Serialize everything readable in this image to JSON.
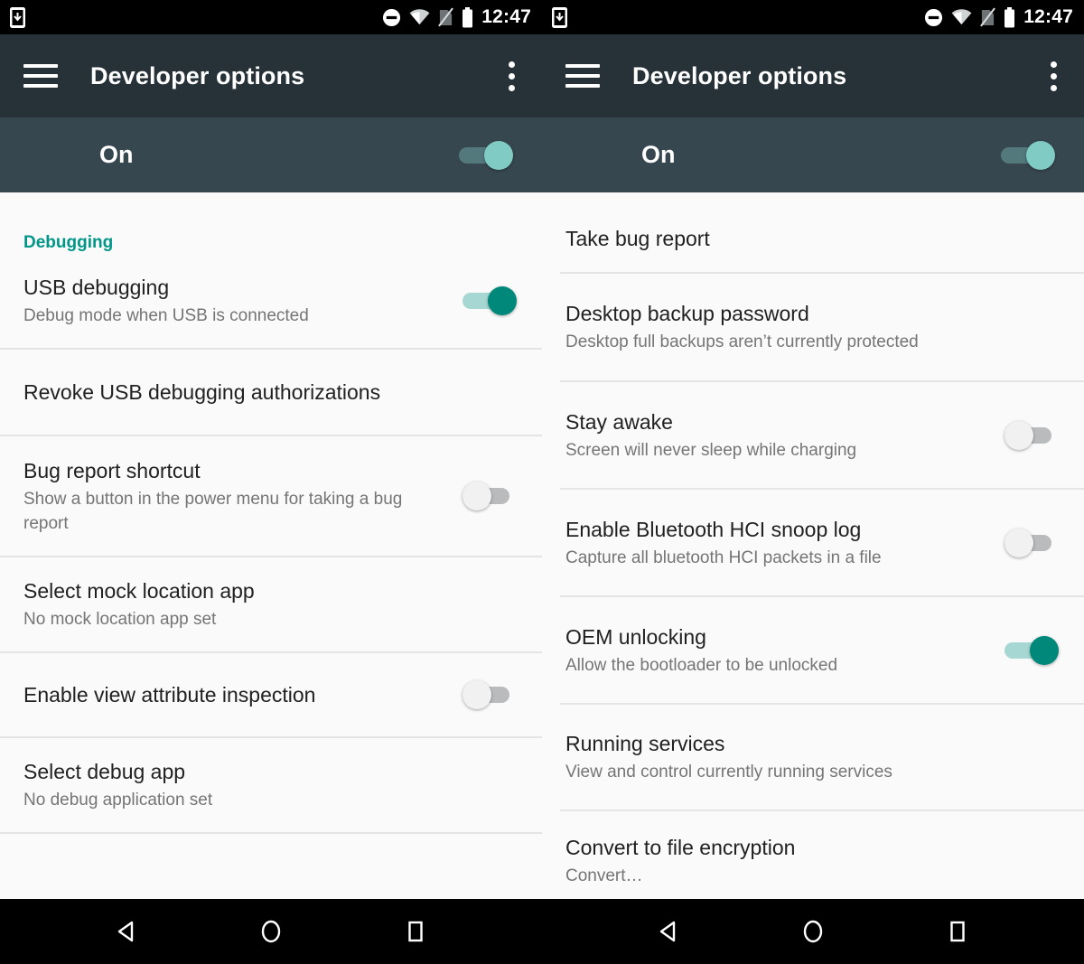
{
  "status_bar": {
    "left_icons": [
      "phone-download-icon"
    ],
    "right_icons": [
      "do-not-disturb-icon",
      "wifi-icon",
      "no-sim-icon",
      "battery-icon"
    ],
    "time": "12:47"
  },
  "toolbar": {
    "menu_icon": "hamburger-menu-icon",
    "title": "Developer options",
    "overflow_icon": "overflow-menu-icon"
  },
  "master_switch": {
    "label": "On",
    "state": "on"
  },
  "colors": {
    "accent_teal": "#009688",
    "toolbar_bg": "#263238",
    "master_bar_bg": "#37474f",
    "list_bg": "#fafafa",
    "title_text": "#212121",
    "sub_text": "#757575",
    "switch_on_thumb": "#00887a",
    "switch_off_thumb": "#f1f1f1"
  },
  "left_panel": {
    "section_header": "Debugging",
    "rows": [
      {
        "title": "USB debugging",
        "sub": "Debug mode when USB is connected",
        "switch": "on"
      },
      {
        "title": "Revoke USB debugging authorizations",
        "sub": "",
        "switch": "none"
      },
      {
        "title": "Bug report shortcut",
        "sub": "Show a button in the power menu for taking a bug report",
        "switch": "off"
      },
      {
        "title": "Select mock location app",
        "sub": "No mock location app set",
        "switch": "none"
      },
      {
        "title": "Enable view attribute inspection",
        "sub": "",
        "switch": "off"
      },
      {
        "title": "Select debug app",
        "sub": "No debug application set",
        "switch": "none"
      }
    ]
  },
  "right_panel": {
    "rows": [
      {
        "title": "Take bug report",
        "sub": "",
        "switch": "none"
      },
      {
        "title": "Desktop backup password",
        "sub": "Desktop full backups aren’t currently protected",
        "switch": "none"
      },
      {
        "title": "Stay awake",
        "sub": "Screen will never sleep while charging",
        "switch": "off"
      },
      {
        "title": "Enable Bluetooth HCI snoop log",
        "sub": "Capture all bluetooth HCI packets in a file",
        "switch": "off"
      },
      {
        "title": "OEM unlocking",
        "sub": "Allow the bootloader to be unlocked",
        "switch": "on"
      },
      {
        "title": "Running services",
        "sub": "View and control currently running services",
        "switch": "none"
      },
      {
        "title": "Convert to file encryption",
        "sub": "Convert…",
        "switch": "none"
      }
    ]
  },
  "nav_bar": {
    "buttons": [
      "back-nav-icon",
      "home-nav-icon",
      "recents-nav-icon"
    ]
  }
}
